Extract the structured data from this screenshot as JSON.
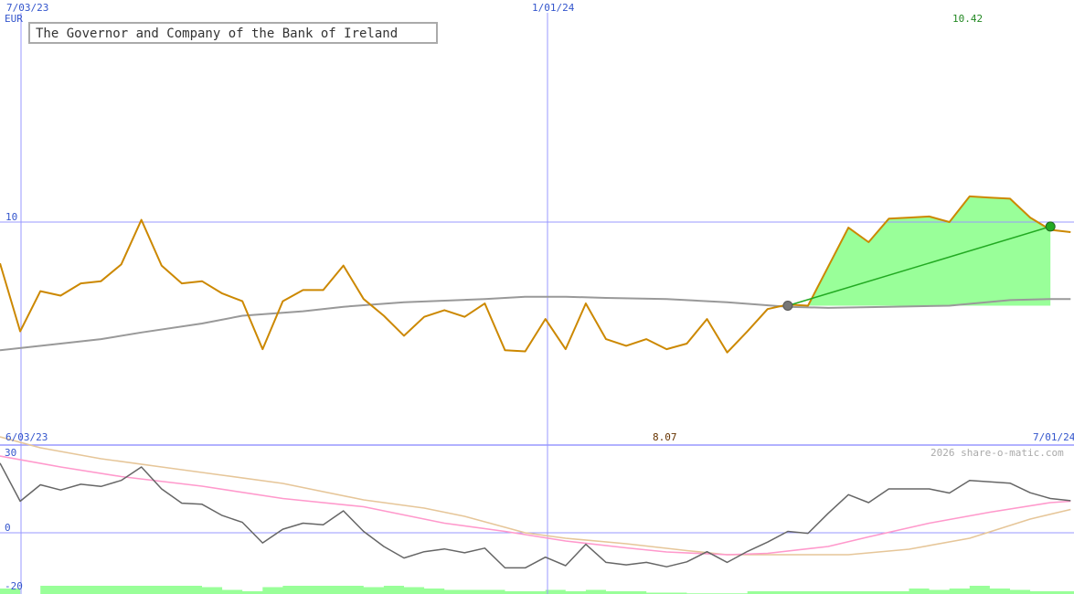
{
  "chart_data": {
    "type": "line",
    "title": "The Governor and Company of the Bank of Ireland",
    "currency": "EUR",
    "date_labels": {
      "start": "7/03/23",
      "mid": "1/01/24",
      "lower_start": "6/03/23",
      "lower_end": "7/01/24"
    },
    "price_axis": {
      "tick": "10",
      "min_label": "8.07",
      "max_label": "10.42"
    },
    "osc_axis": {
      "ticks": [
        "30",
        "0",
        "-20"
      ]
    },
    "credit": "2026 share-o-matic.com",
    "colors": {
      "price": "#cc8800",
      "moving_average": "#999999",
      "forecast_fill": "#99ff99",
      "forecast_line": "#22aa22",
      "grid": "#9999ff",
      "osc_main": "#666666",
      "osc_pink": "#ff99cc",
      "osc_tan": "#e6c699",
      "volume": "#99ff99"
    },
    "price": [
      {
        "i": 0,
        "v": 9.63
      },
      {
        "i": 1,
        "v": 9.02
      },
      {
        "i": 2,
        "v": 9.38
      },
      {
        "i": 3,
        "v": 9.34
      },
      {
        "i": 4,
        "v": 9.45
      },
      {
        "i": 5,
        "v": 9.47
      },
      {
        "i": 6,
        "v": 9.62
      },
      {
        "i": 7,
        "v": 10.02
      },
      {
        "i": 8,
        "v": 9.61
      },
      {
        "i": 9,
        "v": 9.45
      },
      {
        "i": 10,
        "v": 9.47
      },
      {
        "i": 11,
        "v": 9.36
      },
      {
        "i": 12,
        "v": 9.29
      },
      {
        "i": 13,
        "v": 8.86
      },
      {
        "i": 14,
        "v": 9.29
      },
      {
        "i": 15,
        "v": 9.39
      },
      {
        "i": 16,
        "v": 9.39
      },
      {
        "i": 17,
        "v": 9.61
      },
      {
        "i": 18,
        "v": 9.31
      },
      {
        "i": 19,
        "v": 9.16
      },
      {
        "i": 20,
        "v": 8.98
      },
      {
        "i": 21,
        "v": 9.15
      },
      {
        "i": 22,
        "v": 9.21
      },
      {
        "i": 23,
        "v": 9.15
      },
      {
        "i": 24,
        "v": 9.27
      },
      {
        "i": 25,
        "v": 8.85
      },
      {
        "i": 26,
        "v": 8.84
      },
      {
        "i": 27,
        "v": 9.13
      },
      {
        "i": 28,
        "v": 8.86
      },
      {
        "i": 29,
        "v": 9.27
      },
      {
        "i": 30,
        "v": 8.95
      },
      {
        "i": 31,
        "v": 8.89
      },
      {
        "i": 32,
        "v": 8.95
      },
      {
        "i": 33,
        "v": 8.86
      },
      {
        "i": 34,
        "v": 8.91
      },
      {
        "i": 35,
        "v": 9.13
      },
      {
        "i": 36,
        "v": 8.83
      },
      {
        "i": 37,
        "v": 9.02
      },
      {
        "i": 38,
        "v": 9.22
      },
      {
        "i": 39,
        "v": 9.26
      },
      {
        "i": 40,
        "v": 9.25
      },
      {
        "i": 41,
        "v": 9.6
      },
      {
        "i": 42,
        "v": 9.95
      },
      {
        "i": 43,
        "v": 9.82
      },
      {
        "i": 44,
        "v": 10.03
      },
      {
        "i": 45,
        "v": 10.04
      },
      {
        "i": 46,
        "v": 10.05
      },
      {
        "i": 47,
        "v": 10.0
      },
      {
        "i": 48,
        "v": 10.23
      },
      {
        "i": 49,
        "v": 10.22
      },
      {
        "i": 50,
        "v": 10.21
      },
      {
        "i": 51,
        "v": 10.04
      },
      {
        "i": 52,
        "v": 9.93
      },
      {
        "i": 53,
        "v": 9.91
      }
    ],
    "moving_average": [
      {
        "i": 0,
        "v": 8.85
      },
      {
        "i": 5,
        "v": 8.95
      },
      {
        "i": 7,
        "v": 9.01
      },
      {
        "i": 10,
        "v": 9.09
      },
      {
        "i": 12,
        "v": 9.16
      },
      {
        "i": 15,
        "v": 9.2
      },
      {
        "i": 17,
        "v": 9.24
      },
      {
        "i": 20,
        "v": 9.28
      },
      {
        "i": 24,
        "v": 9.31
      },
      {
        "i": 26,
        "v": 9.33
      },
      {
        "i": 28,
        "v": 9.33
      },
      {
        "i": 30,
        "v": 9.32
      },
      {
        "i": 33,
        "v": 9.31
      },
      {
        "i": 36,
        "v": 9.28
      },
      {
        "i": 39,
        "v": 9.24
      },
      {
        "i": 41,
        "v": 9.23
      },
      {
        "i": 44,
        "v": 9.24
      },
      {
        "i": 47,
        "v": 9.25
      },
      {
        "i": 50,
        "v": 9.3
      },
      {
        "i": 52,
        "v": 9.31
      },
      {
        "i": 53,
        "v": 9.31
      }
    ],
    "forecast": {
      "start": {
        "i": 39,
        "v": 9.25
      },
      "end": {
        "i": 52,
        "v": 9.96
      },
      "band_bottom": 9.25
    },
    "oscillator_main": [
      {
        "i": 0,
        "v": 25.4
      },
      {
        "i": 1,
        "v": 11.5
      },
      {
        "i": 2,
        "v": 17.5
      },
      {
        "i": 3,
        "v": 15.6
      },
      {
        "i": 4,
        "v": 17.7
      },
      {
        "i": 5,
        "v": 16.9
      },
      {
        "i": 6,
        "v": 19.1
      },
      {
        "i": 7,
        "v": 24.0
      },
      {
        "i": 8,
        "v": 16.0
      },
      {
        "i": 9,
        "v": 10.8
      },
      {
        "i": 10,
        "v": 10.4
      },
      {
        "i": 11,
        "v": 6.3
      },
      {
        "i": 12,
        "v": 3.8
      },
      {
        "i": 13,
        "v": -3.7
      },
      {
        "i": 14,
        "v": 1.3
      },
      {
        "i": 15,
        "v": 3.5
      },
      {
        "i": 16,
        "v": 2.9
      },
      {
        "i": 17,
        "v": 8.0
      },
      {
        "i": 18,
        "v": 0.5
      },
      {
        "i": 19,
        "v": -5.0
      },
      {
        "i": 20,
        "v": -9.2
      },
      {
        "i": 21,
        "v": -6.9
      },
      {
        "i": 22,
        "v": -5.9
      },
      {
        "i": 23,
        "v": -7.3
      },
      {
        "i": 24,
        "v": -5.6
      },
      {
        "i": 25,
        "v": -12.8
      },
      {
        "i": 26,
        "v": -12.8
      },
      {
        "i": 27,
        "v": -8.9
      },
      {
        "i": 28,
        "v": -12.0
      },
      {
        "i": 29,
        "v": -4.2
      },
      {
        "i": 30,
        "v": -10.8
      },
      {
        "i": 31,
        "v": -11.7
      },
      {
        "i": 32,
        "v": -10.8
      },
      {
        "i": 33,
        "v": -12.4
      },
      {
        "i": 34,
        "v": -10.6
      },
      {
        "i": 35,
        "v": -6.9
      },
      {
        "i": 36,
        "v": -10.8
      },
      {
        "i": 37,
        "v": -6.8
      },
      {
        "i": 38,
        "v": -3.4
      },
      {
        "i": 39,
        "v": 0.5
      },
      {
        "i": 40,
        "v": -0.2
      },
      {
        "i": 41,
        "v": 7.1
      },
      {
        "i": 42,
        "v": 13.9
      },
      {
        "i": 43,
        "v": 11.0
      },
      {
        "i": 44,
        "v": 16.0
      },
      {
        "i": 45,
        "v": 16.0
      },
      {
        "i": 46,
        "v": 16.0
      },
      {
        "i": 47,
        "v": 14.5
      },
      {
        "i": 48,
        "v": 19.1
      },
      {
        "i": 49,
        "v": 18.6
      },
      {
        "i": 50,
        "v": 18.1
      },
      {
        "i": 51,
        "v": 14.6
      },
      {
        "i": 52,
        "v": 12.5
      },
      {
        "i": 53,
        "v": 11.7
      }
    ],
    "oscillator_pink": [
      {
        "i": 0,
        "v": 28.0
      },
      {
        "i": 3,
        "v": 24.0
      },
      {
        "i": 6,
        "v": 20.5
      },
      {
        "i": 10,
        "v": 17.0
      },
      {
        "i": 14,
        "v": 12.5
      },
      {
        "i": 18,
        "v": 9.5
      },
      {
        "i": 20,
        "v": 6.5
      },
      {
        "i": 22,
        "v": 3.5
      },
      {
        "i": 25,
        "v": 0.5
      },
      {
        "i": 28,
        "v": -3.0
      },
      {
        "i": 31,
        "v": -5.5
      },
      {
        "i": 33,
        "v": -7.0
      },
      {
        "i": 36,
        "v": -8.0
      },
      {
        "i": 38,
        "v": -7.5
      },
      {
        "i": 41,
        "v": -5.0
      },
      {
        "i": 43,
        "v": -1.5
      },
      {
        "i": 46,
        "v": 3.5
      },
      {
        "i": 49,
        "v": 7.5
      },
      {
        "i": 52,
        "v": 11.0
      },
      {
        "i": 53,
        "v": 11.5
      }
    ],
    "oscillator_tan": [
      {
        "i": 0,
        "v": 35.0
      },
      {
        "i": 2,
        "v": 31.0
      },
      {
        "i": 5,
        "v": 27.0
      },
      {
        "i": 8,
        "v": 24.0
      },
      {
        "i": 11,
        "v": 21.0
      },
      {
        "i": 14,
        "v": 18.0
      },
      {
        "i": 18,
        "v": 12.0
      },
      {
        "i": 21,
        "v": 9.0
      },
      {
        "i": 23,
        "v": 6.0
      },
      {
        "i": 26,
        "v": 0.0
      },
      {
        "i": 28,
        "v": -2.0
      },
      {
        "i": 31,
        "v": -4.0
      },
      {
        "i": 34,
        "v": -6.5
      },
      {
        "i": 36,
        "v": -8.0
      },
      {
        "i": 38,
        "v": -8.0
      },
      {
        "i": 42,
        "v": -8.0
      },
      {
        "i": 45,
        "v": -6.0
      },
      {
        "i": 48,
        "v": -2.0
      },
      {
        "i": 51,
        "v": 5.0
      },
      {
        "i": 53,
        "v": 8.5
      }
    ],
    "volume": [
      {
        "i": 0,
        "v": 0.4
      },
      {
        "i": 2,
        "v": 0.6
      },
      {
        "i": 3,
        "v": 0.6
      },
      {
        "i": 4,
        "v": 0.6
      },
      {
        "i": 5,
        "v": 0.6
      },
      {
        "i": 6,
        "v": 0.6
      },
      {
        "i": 7,
        "v": 0.6
      },
      {
        "i": 8,
        "v": 0.6
      },
      {
        "i": 9,
        "v": 0.6
      },
      {
        "i": 10,
        "v": 0.5
      },
      {
        "i": 11,
        "v": 0.3
      },
      {
        "i": 12,
        "v": 0.2
      },
      {
        "i": 13,
        "v": 0.5
      },
      {
        "i": 14,
        "v": 0.6
      },
      {
        "i": 15,
        "v": 0.6
      },
      {
        "i": 16,
        "v": 0.6
      },
      {
        "i": 17,
        "v": 0.6
      },
      {
        "i": 18,
        "v": 0.5
      },
      {
        "i": 19,
        "v": 0.6
      },
      {
        "i": 20,
        "v": 0.5
      },
      {
        "i": 21,
        "v": 0.4
      },
      {
        "i": 22,
        "v": 0.3
      },
      {
        "i": 23,
        "v": 0.3
      },
      {
        "i": 24,
        "v": 0.3
      },
      {
        "i": 25,
        "v": 0.2
      },
      {
        "i": 26,
        "v": 0.2
      },
      {
        "i": 27,
        "v": 0.3
      },
      {
        "i": 28,
        "v": 0.2
      },
      {
        "i": 29,
        "v": 0.3
      },
      {
        "i": 30,
        "v": 0.2
      },
      {
        "i": 31,
        "v": 0.2
      },
      {
        "i": 32,
        "v": 0.1
      },
      {
        "i": 33,
        "v": 0.1
      },
      {
        "i": 34,
        "v": 0.05
      },
      {
        "i": 35,
        "v": 0.05
      },
      {
        "i": 36,
        "v": 0.05
      },
      {
        "i": 37,
        "v": 0.2
      },
      {
        "i": 38,
        "v": 0.2
      },
      {
        "i": 39,
        "v": 0.2
      },
      {
        "i": 40,
        "v": 0.2
      },
      {
        "i": 41,
        "v": 0.2
      },
      {
        "i": 42,
        "v": 0.2
      },
      {
        "i": 43,
        "v": 0.2
      },
      {
        "i": 44,
        "v": 0.2
      },
      {
        "i": 45,
        "v": 0.4
      },
      {
        "i": 46,
        "v": 0.3
      },
      {
        "i": 47,
        "v": 0.4
      },
      {
        "i": 48,
        "v": 0.6
      },
      {
        "i": 49,
        "v": 0.4
      },
      {
        "i": 50,
        "v": 0.3
      },
      {
        "i": 51,
        "v": 0.2
      },
      {
        "i": 52,
        "v": 0.2
      },
      {
        "i": 53,
        "v": 0.2
      }
    ]
  }
}
